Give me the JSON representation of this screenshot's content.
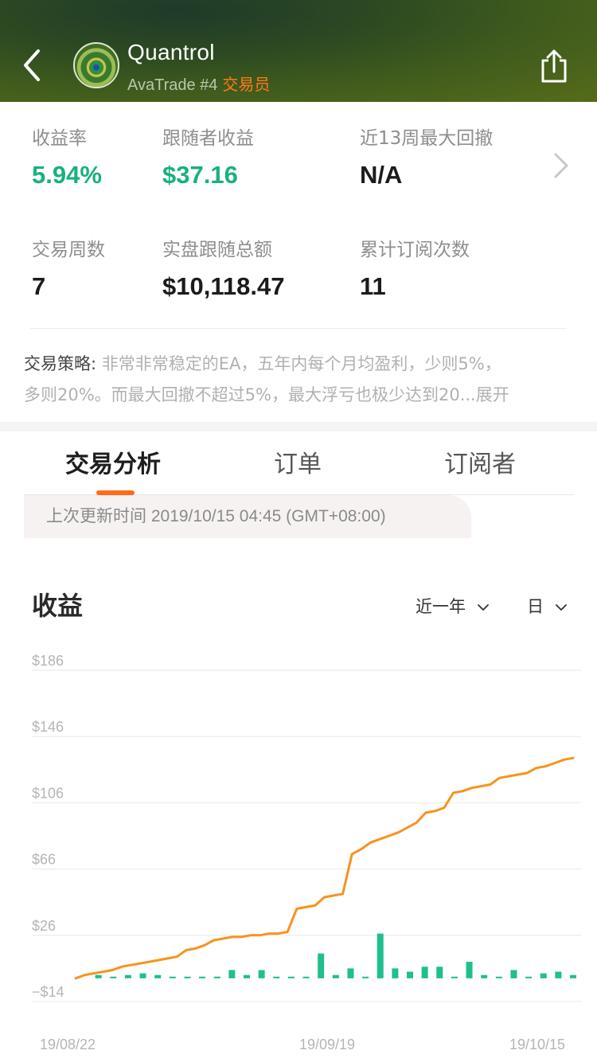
{
  "header": {
    "name": "Quantrol",
    "broker_rank": "AvaTrade #4",
    "role": "交易员"
  },
  "stats": [
    {
      "label": "收益率",
      "value": "5.94%",
      "color": "#19b07f"
    },
    {
      "label": "跟随者收益",
      "value": "$37.16",
      "color": "#19b07f"
    },
    {
      "label": "近13周最大回撤",
      "value": "N/A"
    },
    {
      "label": "交易周数",
      "value": "7"
    },
    {
      "label": "实盘跟随总额",
      "value": "$10,118.47"
    },
    {
      "label": "累计订阅次数",
      "value": "11"
    }
  ],
  "strategy": {
    "label": "交易策略:",
    "text_line1": "非常非常稳定的EA，五年内每个月均盈利，少则5%，",
    "text_line2": "多则20%。而最大回撤不超过5%，最大浮亏也极少达到20...",
    "expand": "展开"
  },
  "tabs": [
    {
      "label": "交易分析",
      "active": true
    },
    {
      "label": "订单",
      "active": false
    },
    {
      "label": "订阅者",
      "active": false
    }
  ],
  "update_text": "上次更新时间 2019/10/15 04:45 (GMT+08:00)",
  "section": {
    "title": "收益",
    "range": "近一年",
    "granularity": "日"
  },
  "colors": {
    "accent": "#ff6a1a",
    "green": "#19b07f",
    "line": "#f7931e",
    "bar": "#1fbf8f"
  },
  "chart_data": {
    "type": "line",
    "y_tick_labels": [
      "$186",
      "$146",
      "$106",
      "$66",
      "$26",
      "−$14"
    ],
    "y_ticks": [
      186,
      146,
      106,
      66,
      26,
      -14
    ],
    "ylim": [
      -14,
      186
    ],
    "x_tick_labels": [
      "19/08/22",
      "19/09/19",
      "19/10/15"
    ],
    "x_tick_index": [
      0,
      28,
      54
    ],
    "grid": true,
    "series": [
      {
        "kind": "line",
        "values": [
          0,
          2,
          3,
          4,
          5,
          7,
          8,
          9,
          10,
          11,
          12,
          13,
          17,
          18,
          20,
          23,
          24,
          25,
          25,
          26,
          26,
          27,
          27,
          28,
          42,
          43,
          44,
          49,
          50,
          51,
          75,
          78,
          82,
          84,
          86,
          88,
          91,
          94,
          100,
          101,
          103,
          112,
          113,
          115,
          116,
          117,
          121,
          122,
          123,
          124,
          127,
          128,
          130,
          132,
          133
        ]
      },
      {
        "kind": "bar",
        "values": [
          0,
          2,
          1,
          2,
          3,
          2,
          1,
          1,
          1,
          1,
          5,
          2,
          5,
          1,
          1,
          1,
          15,
          2,
          6,
          1,
          27,
          6,
          4,
          7,
          7,
          1,
          10,
          2,
          1,
          5,
          1,
          3,
          4,
          2
        ]
      }
    ]
  }
}
